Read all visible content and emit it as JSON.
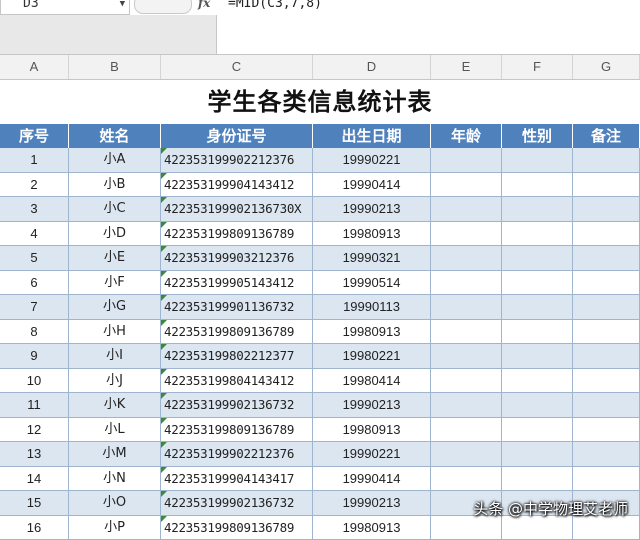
{
  "formula_bar": {
    "cell_ref": "D3",
    "fx_label": "fx",
    "formula": "=MID(C3,7,8)"
  },
  "columns": [
    "A",
    "B",
    "C",
    "D",
    "E",
    "F",
    "G"
  ],
  "title": "学生各类信息统计表",
  "headers": [
    "序号",
    "姓名",
    "身份证号",
    "出生日期",
    "年龄",
    "性别",
    "备注"
  ],
  "rows": [
    {
      "no": "1",
      "name": "小A",
      "id": "422353199902212376",
      "birth": "19990221"
    },
    {
      "no": "2",
      "name": "小B",
      "id": "422353199904143412",
      "birth": "19990414"
    },
    {
      "no": "3",
      "name": "小C",
      "id": "422353199902136730X",
      "birth": "19990213"
    },
    {
      "no": "4",
      "name": "小D",
      "id": "422353199809136789",
      "birth": "19980913"
    },
    {
      "no": "5",
      "name": "小E",
      "id": "422353199903212376",
      "birth": "19990321"
    },
    {
      "no": "6",
      "name": "小F",
      "id": "422353199905143412",
      "birth": "19990514"
    },
    {
      "no": "7",
      "name": "小G",
      "id": "422353199901136732",
      "birth": "19990113"
    },
    {
      "no": "8",
      "name": "小H",
      "id": "422353199809136789",
      "birth": "19980913"
    },
    {
      "no": "9",
      "name": "小I",
      "id": "422353199802212377",
      "birth": "19980221"
    },
    {
      "no": "10",
      "name": "小J",
      "id": "422353199804143412",
      "birth": "19980414"
    },
    {
      "no": "11",
      "name": "小K",
      "id": "422353199902136732",
      "birth": "19990213"
    },
    {
      "no": "12",
      "name": "小L",
      "id": "422353199809136789",
      "birth": "19980913"
    },
    {
      "no": "13",
      "name": "小M",
      "id": "422353199902212376",
      "birth": "19990221"
    },
    {
      "no": "14",
      "name": "小N",
      "id": "422353199904143417",
      "birth": "19990414"
    },
    {
      "no": "15",
      "name": "小O",
      "id": "422353199902136732",
      "birth": "19990213"
    },
    {
      "no": "16",
      "name": "小P",
      "id": "422353199809136789",
      "birth": "19980913"
    }
  ],
  "watermark": "头条 @中学物理艾老师",
  "colors": {
    "header_blue": "#4f81bd",
    "band_blue": "#dce6f1",
    "grid": "#9fb4cf",
    "error_triangle": "#3a8a3a"
  }
}
